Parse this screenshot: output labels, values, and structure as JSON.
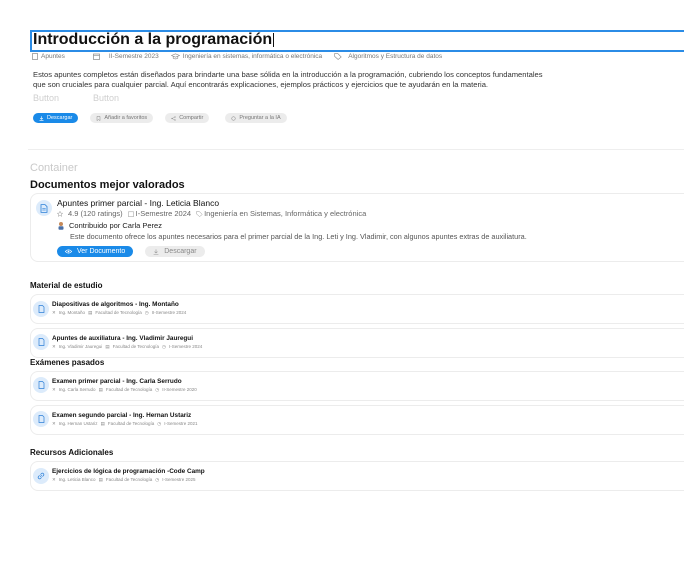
{
  "header": {
    "title": "Introducción a la programación",
    "meta": {
      "type": "Apuntes",
      "semester": "II-Semestre 2023",
      "career": "Ingeniería en sistemas, informática o electrónica",
      "subject": "Algoritmos y Estructura de datos"
    },
    "description": "Estos apuntes completos están diseñados para brindarte una base sólida en la introducción a la programación, cubriendo los conceptos fundamentales que son cruciales para cualquier parcial. Aquí encontrarás explicaciones, ejemplos prácticos y ejercicios que te ayudarán en la materia.",
    "ghost_labels": [
      "Button",
      "Button"
    ],
    "actions": {
      "download": "Descargar",
      "favorite": "Añadir a favoritos",
      "share": "Compartir",
      "ask_ai": "Preguntar a la IA"
    }
  },
  "container_label": "Container",
  "top_rated": {
    "title": "Documentos mejor valorados",
    "item": {
      "title": "Apuntes primer parcial - Ing. Leticia Blanco",
      "rating": "4.9 (120 ratings)",
      "semester": "I-Semestre 2024",
      "career": "Ingeniería en Sistemas, Informática y electrónica",
      "contributor": "Contribuido por Carla Perez",
      "description": "Este documento ofrece  los apuntes necesarios para el primer parcial de la Ing. Leti y Ing. Vladimir, con algunos apuntes extras de auxiliatura.",
      "view_label": "Ver Documento",
      "download_label": "Descargar"
    }
  },
  "sections": {
    "study_material": {
      "title": "Material de estudio",
      "items": [
        {
          "title": "Diapositivas de algoritmos - Ing. Montaño",
          "author": "Ing. Montaño",
          "faculty": "Facultad de Tecnología",
          "semester": "II-Semestre 2024"
        },
        {
          "title": "Apuntes de auxiliatura - Ing. Vladimir Jauregui",
          "author": "Ing. Vladimir Jauregui",
          "faculty": "Facultad de Tecnología",
          "semester": "I-Semestre 2024"
        }
      ]
    },
    "past_exams": {
      "title": "Exámenes pasados",
      "items": [
        {
          "title": "Examen primer parcial - Ing. Carla Serrudo",
          "author": "Ing. Carla Serrudo",
          "faculty": "Facultad de Tecnología",
          "semester": "II-Semestre 2020"
        },
        {
          "title": "Examen segundo parcial - Ing. Hernan Ustariz",
          "author": "Ing. Hernan Ustariz",
          "faculty": "Facultad de Tecnología",
          "semester": "I-Semestre 2021"
        }
      ]
    },
    "additional": {
      "title": "Recursos Adicionales",
      "items": [
        {
          "title": "Ejercicios de lógica de programación -Code Camp",
          "author": "Ing. Leticia Blanco",
          "faculty": "Facultad de Tecnología",
          "semester": "I-Semestre 2025"
        }
      ]
    }
  },
  "colors": {
    "accent": "#1a8ae8",
    "focus_border": "#2b8ce6",
    "badge_bg": "#dcebfb"
  }
}
